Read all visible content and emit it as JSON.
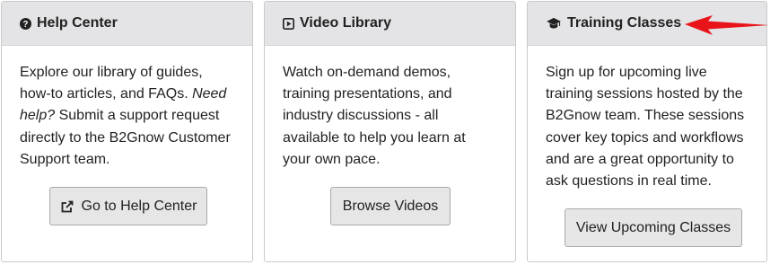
{
  "cards": {
    "help": {
      "title": "Help Center",
      "icon": "question-circle-icon",
      "text_before": "Explore our library of guides, how-to articles, and FAQs. ",
      "text_em": "Need help?",
      "text_after": " Submit a support request directly to the B2Gnow Customer Support team.",
      "button_label": "Go to Help Center",
      "button_icon": "external-link-icon"
    },
    "video": {
      "title": "Video Library",
      "icon": "play-square-icon",
      "text": "Watch on-demand demos, training presentations, and industry discussions - all available to help you learn at your own pace.",
      "button_label": "Browse Videos"
    },
    "training": {
      "title": "Training Classes",
      "icon": "graduation-cap-icon",
      "text": "Sign up for upcoming live training sessions hosted by the B2Gnow team. These sessions cover key topics and workflows and are a great opportunity to ask questions in real time.",
      "button_label": "View Upcoming Classes"
    }
  },
  "annotation": {
    "arrow_color": "#e8141a",
    "icon": "red-arrow-pointing-left"
  }
}
